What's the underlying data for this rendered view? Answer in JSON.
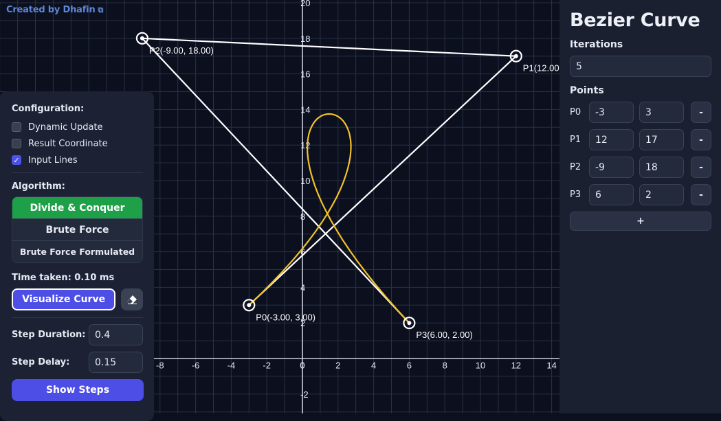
{
  "credit": {
    "text": "Created by Dhafin",
    "icon": "external-link-icon"
  },
  "config": {
    "title": "Configuration:",
    "options": [
      {
        "label": "Dynamic Update",
        "checked": false
      },
      {
        "label": "Result Coordinate",
        "checked": false
      },
      {
        "label": "Input Lines",
        "checked": true
      }
    ],
    "algorithm_title": "Algorithm:",
    "algorithms": [
      "Divide & Conquer",
      "Brute Force",
      "Brute Force Formulated"
    ],
    "selected_algorithm": "Divide & Conquer",
    "time_taken": "Time taken: 0.10 ms",
    "visualize_label": "Visualize Curve",
    "step_duration_label": "Step Duration:",
    "step_duration": "0.4",
    "step_delay_label": "Step Delay:",
    "step_delay": "0.15",
    "show_steps_label": "Show Steps"
  },
  "side": {
    "title": "Bezier Curve",
    "iterations_label": "Iterations",
    "iterations": "5",
    "points_label": "Points",
    "points": [
      {
        "name": "P0",
        "x": "-3",
        "y": "3"
      },
      {
        "name": "P1",
        "x": "12",
        "y": "17"
      },
      {
        "name": "P2",
        "x": "-9",
        "y": "18"
      },
      {
        "name": "P3",
        "x": "6",
        "y": "2"
      }
    ],
    "remove_label": "-",
    "add_label": "+"
  },
  "chart_data": {
    "type": "line",
    "control_points": [
      {
        "label": "P0(-3.00, 3.00)",
        "x": -3,
        "y": 3
      },
      {
        "label": "P1(12.00",
        "x": 12,
        "y": 17
      },
      {
        "label": "P2(-9.00, 18.00)",
        "x": -9,
        "y": 18
      },
      {
        "label": "P3(6.00, 2.00)",
        "x": 6,
        "y": 2
      }
    ],
    "x_ticks": [
      -8,
      -6,
      -4,
      -2,
      0,
      2,
      4,
      6,
      8,
      10,
      12,
      14
    ],
    "y_ticks": [
      -2,
      2,
      4,
      6,
      8,
      10,
      12,
      14,
      16,
      18,
      20
    ],
    "curve_color": "#f3c12a",
    "input_line_color": "#ffffff",
    "grid_color": "#2a3246",
    "grid": true
  }
}
